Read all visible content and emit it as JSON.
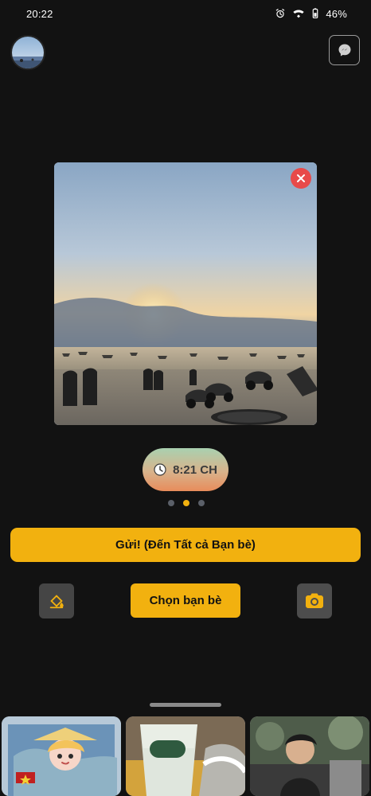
{
  "status_bar": {
    "time": "20:22",
    "battery": "46%",
    "icons": [
      "alarm-icon",
      "wifi-icon",
      "battery-icon"
    ]
  },
  "header": {
    "avatar_icon": "avatar",
    "messenger_icon": "messenger-icon"
  },
  "photo": {
    "close_icon": "close-icon"
  },
  "time_badge": {
    "label": "8:21 CH",
    "icon": "clock-icon"
  },
  "pagination": {
    "count": 3,
    "active_index": 1
  },
  "actions": {
    "send_all_label": "Gửi! (Đến Tất cả Bạn bè)",
    "choose_friends_label": "Chọn bạn bè",
    "fill_icon": "paint-bucket-icon",
    "camera_icon": "camera-icon"
  },
  "gallery": {
    "items": [
      "image",
      "image",
      "image"
    ]
  },
  "colors": {
    "accent": "#F2B10F",
    "background": "#121212",
    "close": "#E84A4A"
  }
}
